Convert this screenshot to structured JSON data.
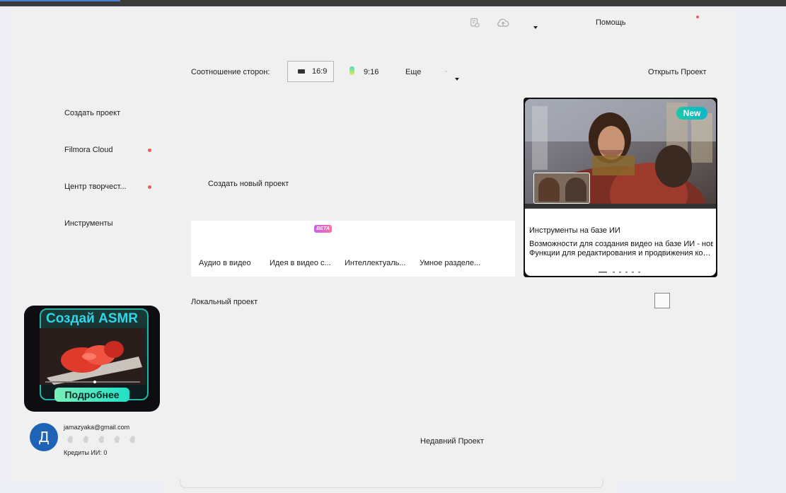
{
  "header": {
    "help_label": "Помощь"
  },
  "aspect": {
    "label": "Соотношение сторон:",
    "ratio_16_9": "16:9",
    "ratio_9_16": "9:16",
    "more_label": "Еще",
    "open_project": "Открыть Проект"
  },
  "sidebar": {
    "items": [
      {
        "label": "Создать проект"
      },
      {
        "label": "Filmora Cloud"
      },
      {
        "label": "Центр творчест..."
      },
      {
        "label": "Инструменты"
      }
    ]
  },
  "main": {
    "create_new": "Создать новый проект",
    "beta_badge": "BETA",
    "tools": [
      {
        "label": "Аудио в видео"
      },
      {
        "label": "Идея в видео с..."
      },
      {
        "label": "Интеллектуаль..."
      },
      {
        "label": "Умное разделе..."
      }
    ],
    "local_project": "Локальный проект",
    "recent_project": "Недавний Проект"
  },
  "promo": {
    "badge": "New",
    "line1": "Инструменты на базе ИИ",
    "line2": "Возможности для создания видео на базе ИИ - новые",
    "line3": "Функции для редактирования и продвижения контента..."
  },
  "asmr": {
    "title": "Создай ASMR",
    "button": "Подробнее"
  },
  "user": {
    "avatar_letter": "Д",
    "email": "jamazyaka@gmail.com",
    "credits": "Кредиты ИИ: 0"
  },
  "colors": {
    "accent_red": "#ef5b5b",
    "avatar_blue": "#1e63b5",
    "new_badge": "#1bc7a8",
    "asmr_title": "#2fd6e6",
    "asmr_button": "#22e0c8"
  }
}
